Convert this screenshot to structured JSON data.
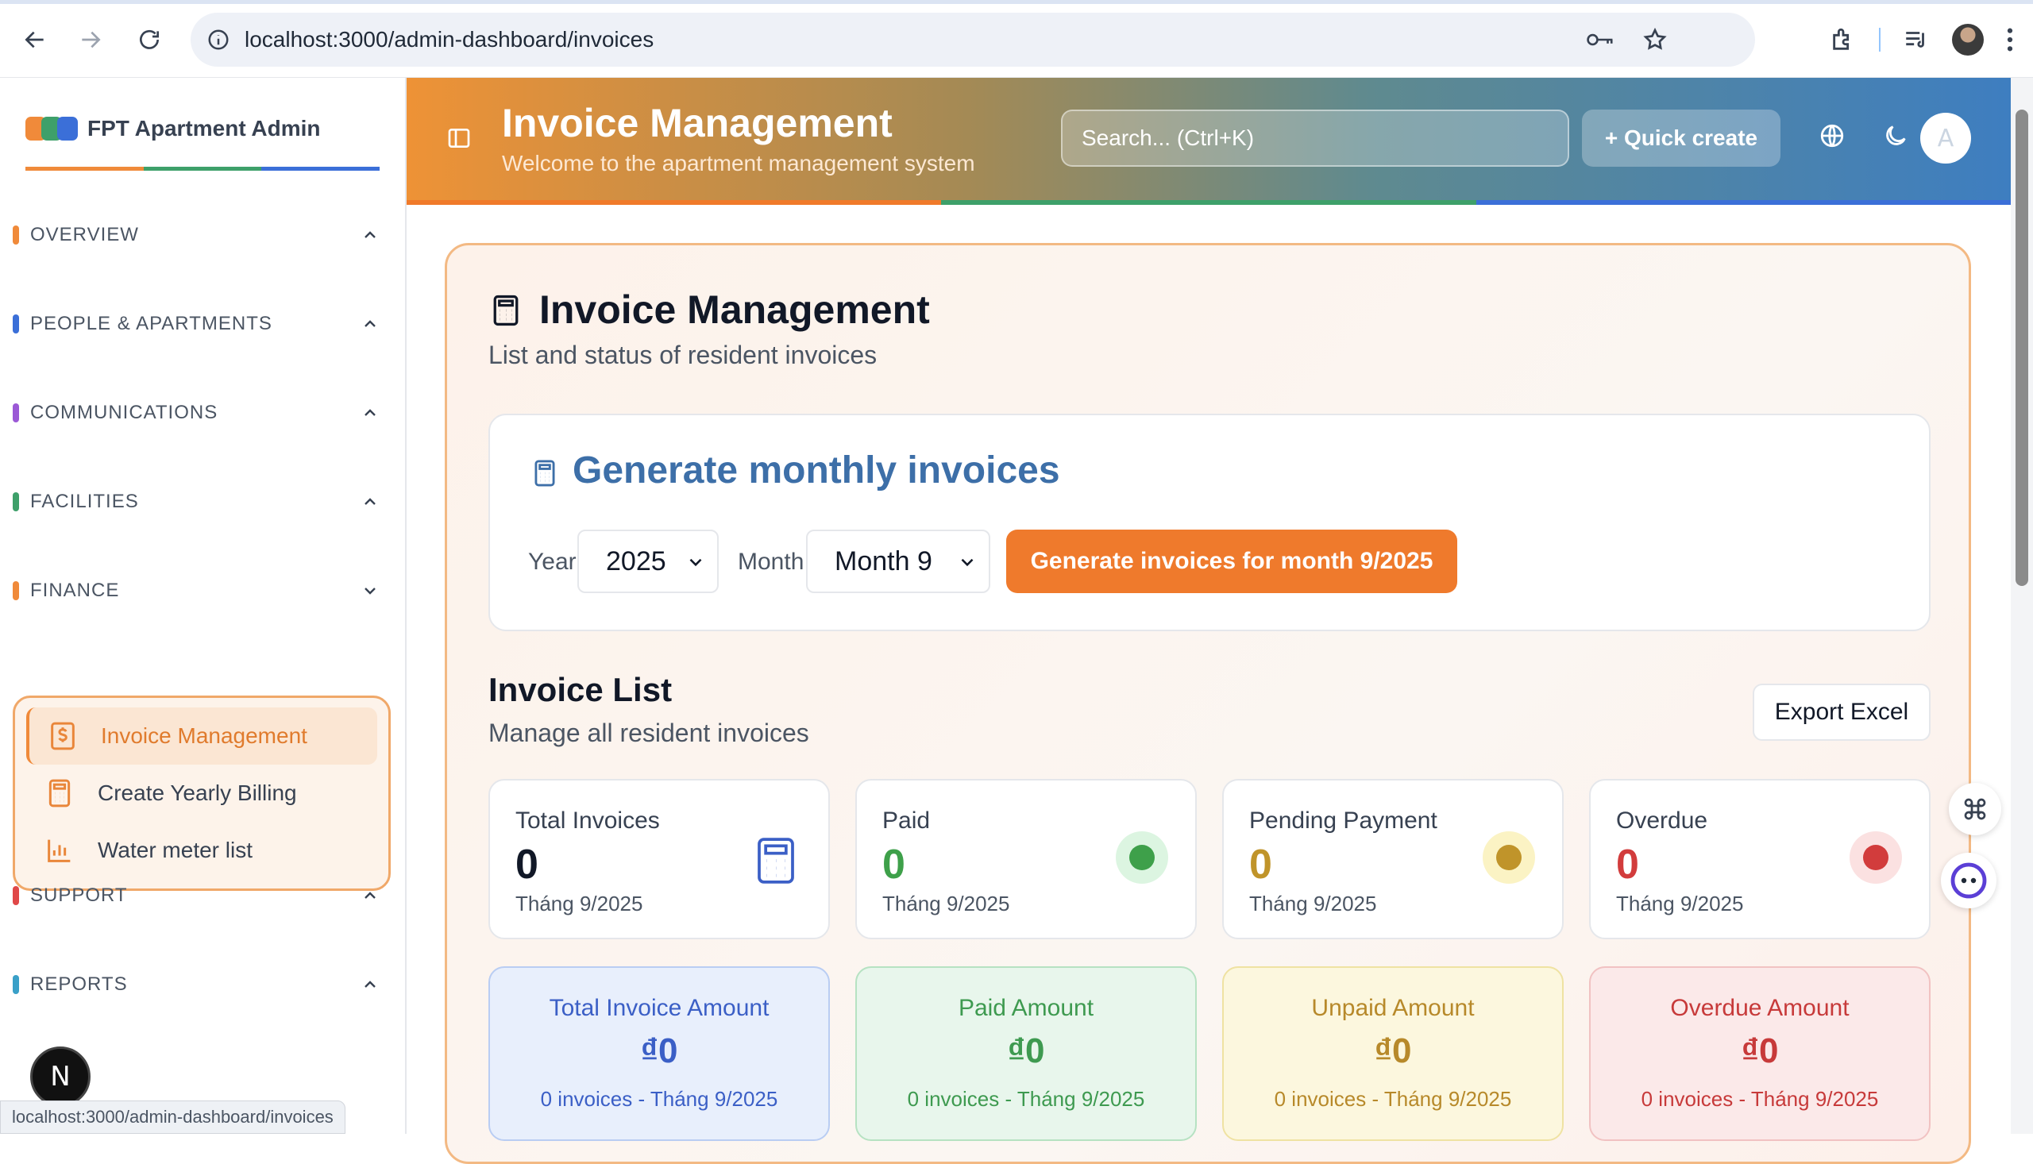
{
  "browser": {
    "url": "localhost:3000/admin-dashboard/invoices"
  },
  "sidebar": {
    "brand": "FPT Apartment Admin",
    "sections": [
      {
        "label": "OVERVIEW",
        "color": "#f08a3a"
      },
      {
        "label": "PEOPLE & APARTMENTS",
        "color": "#3b6fd8"
      },
      {
        "label": "COMMUNICATIONS",
        "color": "#9b59d6"
      },
      {
        "label": "FACILITIES",
        "color": "#3ea06a"
      },
      {
        "label": "FINANCE",
        "color": "#f08a3a"
      },
      {
        "label": "SUPPORT",
        "color": "#e04848"
      },
      {
        "label": "REPORTS",
        "color": "#3aa0c8"
      }
    ],
    "finance_items": [
      {
        "label": "Invoice Management",
        "icon": "dollar-invoice-icon",
        "active": true
      },
      {
        "label": "Create Yearly Billing",
        "icon": "calculator-icon"
      },
      {
        "label": "Water meter list",
        "icon": "bar-chart-icon"
      }
    ],
    "n_badge": "N",
    "status_url": "localhost:3000/admin-dashboard/invoices"
  },
  "header": {
    "title": "Invoice Management",
    "subtitle": "Welcome to the apartment management system",
    "search_placeholder": "Search... (Ctrl+K)",
    "quick_create": "+ Quick create",
    "avatar": "A"
  },
  "main": {
    "title": "Invoice Management",
    "subtitle": "List and status of resident invoices",
    "generate": {
      "title": "Generate monthly invoices",
      "year_label": "Year",
      "year_value": "2025",
      "month_label": "Month",
      "month_value": "Month 9",
      "button": "Generate invoices for month 9/2025"
    },
    "list": {
      "title": "Invoice List",
      "subtitle": "Manage all resident invoices",
      "export": "Export Excel"
    },
    "stats": [
      {
        "label": "Total Invoices",
        "value": "0",
        "period": "Tháng 9/2025",
        "color": "#111827"
      },
      {
        "label": "Paid",
        "value": "0",
        "period": "Tháng 9/2025",
        "color": "#3ea04a"
      },
      {
        "label": "Pending Payment",
        "value": "0",
        "period": "Tháng 9/2025",
        "color": "#c0942a"
      },
      {
        "label": "Overdue",
        "value": "0",
        "period": "Tháng 9/2025",
        "color": "#d23c3c"
      }
    ],
    "amounts": [
      {
        "label": "Total Invoice Amount",
        "value": "₫0",
        "sub": "0 invoices - Tháng 9/2025",
        "color": "#3b5fc6",
        "bg": "#e8effc",
        "border": "#b9cdf3"
      },
      {
        "label": "Paid Amount",
        "value": "₫0",
        "sub": "0 invoices - Tháng 9/2025",
        "color": "#3e9a50",
        "bg": "#e8f6ec",
        "border": "#b6e2c2"
      },
      {
        "label": "Unpaid Amount",
        "value": "₫0",
        "sub": "0 invoices - Tháng 9/2025",
        "color": "#b7892a",
        "bg": "#fcf7de",
        "border": "#efe2a2"
      },
      {
        "label": "Overdue Amount",
        "value": "₫0",
        "sub": "0 invoices - Tháng 9/2025",
        "color": "#c73a3a",
        "bg": "#fbe9e9",
        "border": "#f1c2c2"
      }
    ]
  }
}
